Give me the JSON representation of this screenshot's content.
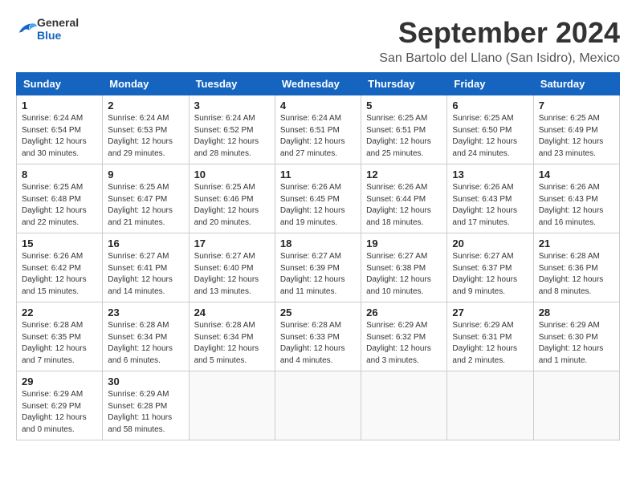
{
  "header": {
    "logo_general": "General",
    "logo_blue": "Blue",
    "title": "September 2024",
    "location": "San Bartolo del Llano (San Isidro), Mexico"
  },
  "weekdays": [
    "Sunday",
    "Monday",
    "Tuesday",
    "Wednesday",
    "Thursday",
    "Friday",
    "Saturday"
  ],
  "weeks": [
    [
      {
        "day": 1,
        "sunrise": "6:24 AM",
        "sunset": "6:54 PM",
        "daylight": "12 hours and 30 minutes."
      },
      {
        "day": 2,
        "sunrise": "6:24 AM",
        "sunset": "6:53 PM",
        "daylight": "12 hours and 29 minutes."
      },
      {
        "day": 3,
        "sunrise": "6:24 AM",
        "sunset": "6:52 PM",
        "daylight": "12 hours and 28 minutes."
      },
      {
        "day": 4,
        "sunrise": "6:24 AM",
        "sunset": "6:51 PM",
        "daylight": "12 hours and 27 minutes."
      },
      {
        "day": 5,
        "sunrise": "6:25 AM",
        "sunset": "6:51 PM",
        "daylight": "12 hours and 25 minutes."
      },
      {
        "day": 6,
        "sunrise": "6:25 AM",
        "sunset": "6:50 PM",
        "daylight": "12 hours and 24 minutes."
      },
      {
        "day": 7,
        "sunrise": "6:25 AM",
        "sunset": "6:49 PM",
        "daylight": "12 hours and 23 minutes."
      }
    ],
    [
      {
        "day": 8,
        "sunrise": "6:25 AM",
        "sunset": "6:48 PM",
        "daylight": "12 hours and 22 minutes."
      },
      {
        "day": 9,
        "sunrise": "6:25 AM",
        "sunset": "6:47 PM",
        "daylight": "12 hours and 21 minutes."
      },
      {
        "day": 10,
        "sunrise": "6:25 AM",
        "sunset": "6:46 PM",
        "daylight": "12 hours and 20 minutes."
      },
      {
        "day": 11,
        "sunrise": "6:26 AM",
        "sunset": "6:45 PM",
        "daylight": "12 hours and 19 minutes."
      },
      {
        "day": 12,
        "sunrise": "6:26 AM",
        "sunset": "6:44 PM",
        "daylight": "12 hours and 18 minutes."
      },
      {
        "day": 13,
        "sunrise": "6:26 AM",
        "sunset": "6:43 PM",
        "daylight": "12 hours and 17 minutes."
      },
      {
        "day": 14,
        "sunrise": "6:26 AM",
        "sunset": "6:43 PM",
        "daylight": "12 hours and 16 minutes."
      }
    ],
    [
      {
        "day": 15,
        "sunrise": "6:26 AM",
        "sunset": "6:42 PM",
        "daylight": "12 hours and 15 minutes."
      },
      {
        "day": 16,
        "sunrise": "6:27 AM",
        "sunset": "6:41 PM",
        "daylight": "12 hours and 14 minutes."
      },
      {
        "day": 17,
        "sunrise": "6:27 AM",
        "sunset": "6:40 PM",
        "daylight": "12 hours and 13 minutes."
      },
      {
        "day": 18,
        "sunrise": "6:27 AM",
        "sunset": "6:39 PM",
        "daylight": "12 hours and 11 minutes."
      },
      {
        "day": 19,
        "sunrise": "6:27 AM",
        "sunset": "6:38 PM",
        "daylight": "12 hours and 10 minutes."
      },
      {
        "day": 20,
        "sunrise": "6:27 AM",
        "sunset": "6:37 PM",
        "daylight": "12 hours and 9 minutes."
      },
      {
        "day": 21,
        "sunrise": "6:28 AM",
        "sunset": "6:36 PM",
        "daylight": "12 hours and 8 minutes."
      }
    ],
    [
      {
        "day": 22,
        "sunrise": "6:28 AM",
        "sunset": "6:35 PM",
        "daylight": "12 hours and 7 minutes."
      },
      {
        "day": 23,
        "sunrise": "6:28 AM",
        "sunset": "6:34 PM",
        "daylight": "12 hours and 6 minutes."
      },
      {
        "day": 24,
        "sunrise": "6:28 AM",
        "sunset": "6:34 PM",
        "daylight": "12 hours and 5 minutes."
      },
      {
        "day": 25,
        "sunrise": "6:28 AM",
        "sunset": "6:33 PM",
        "daylight": "12 hours and 4 minutes."
      },
      {
        "day": 26,
        "sunrise": "6:29 AM",
        "sunset": "6:32 PM",
        "daylight": "12 hours and 3 minutes."
      },
      {
        "day": 27,
        "sunrise": "6:29 AM",
        "sunset": "6:31 PM",
        "daylight": "12 hours and 2 minutes."
      },
      {
        "day": 28,
        "sunrise": "6:29 AM",
        "sunset": "6:30 PM",
        "daylight": "12 hours and 1 minute."
      }
    ],
    [
      {
        "day": 29,
        "sunrise": "6:29 AM",
        "sunset": "6:29 PM",
        "daylight": "12 hours and 0 minutes."
      },
      {
        "day": 30,
        "sunrise": "6:29 AM",
        "sunset": "6:28 PM",
        "daylight": "11 hours and 58 minutes."
      },
      null,
      null,
      null,
      null,
      null
    ]
  ]
}
